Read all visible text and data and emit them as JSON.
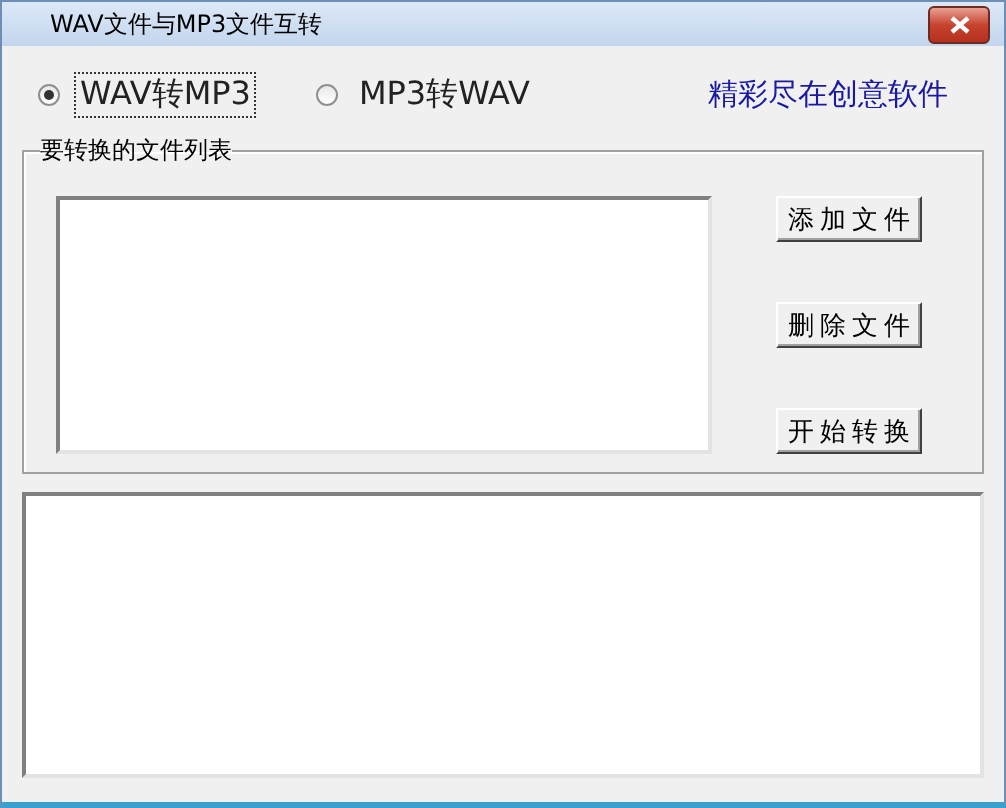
{
  "window": {
    "title": "WAV文件与MP3文件互转"
  },
  "modes": [
    {
      "label": "WAV转MP3",
      "selected": true
    },
    {
      "label": "MP3转WAV",
      "selected": false
    }
  ],
  "slogan": "精彩尽在创意软件",
  "file_group": {
    "label": "要转换的文件列表"
  },
  "buttons": [
    "添加文件",
    "删除文件",
    "开始转换"
  ]
}
